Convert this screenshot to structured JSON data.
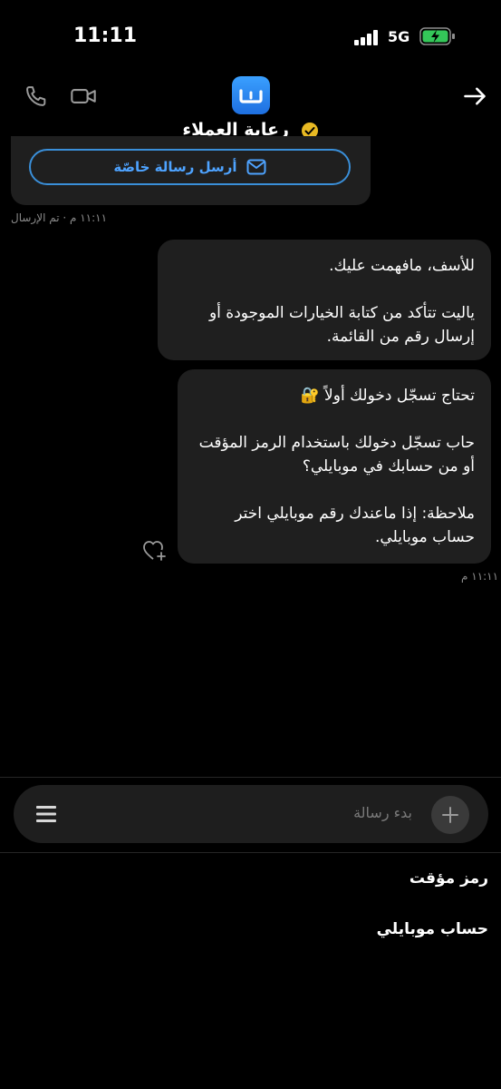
{
  "status_bar": {
    "time": "11:11",
    "network": "5G"
  },
  "header": {
    "title": "رعاية العملاء",
    "back_icon": "arrow-right-icon",
    "call_icon": "phone-icon",
    "video_icon": "video-icon",
    "brand_color": "#2a86f0"
  },
  "previous_card": {
    "button_label": "أرسل رسالة خاصّة",
    "meta": "١١:١١ م · تم الإرسال"
  },
  "messages": [
    {
      "paragraphs": [
        "للأسف، مافهمت عليك.",
        "ياليت تتأكد من كتابة الخيارات الموجودة أو إرسال رقم من القائمة."
      ]
    },
    {
      "paragraphs": [
        "تحتاج تسجّل دخولك أولاً 🔐",
        "حاب تسجّل دخولك باستخدام الرمز المؤقت أو من حسابك في موبايلي؟",
        "ملاحظة: إذا ماعندك رقم موبايلي اختر حساب موبايلي."
      ],
      "time": "١١:١١ م"
    }
  ],
  "composer": {
    "placeholder": "بدء رسالة"
  },
  "quick_replies": [
    "رمز مؤقت",
    "حساب موبايلي"
  ],
  "colors": {
    "background": "#000000",
    "bubble": "#1f1f1f",
    "accent": "#4ea3ff",
    "battery_charge": "#34c759"
  }
}
